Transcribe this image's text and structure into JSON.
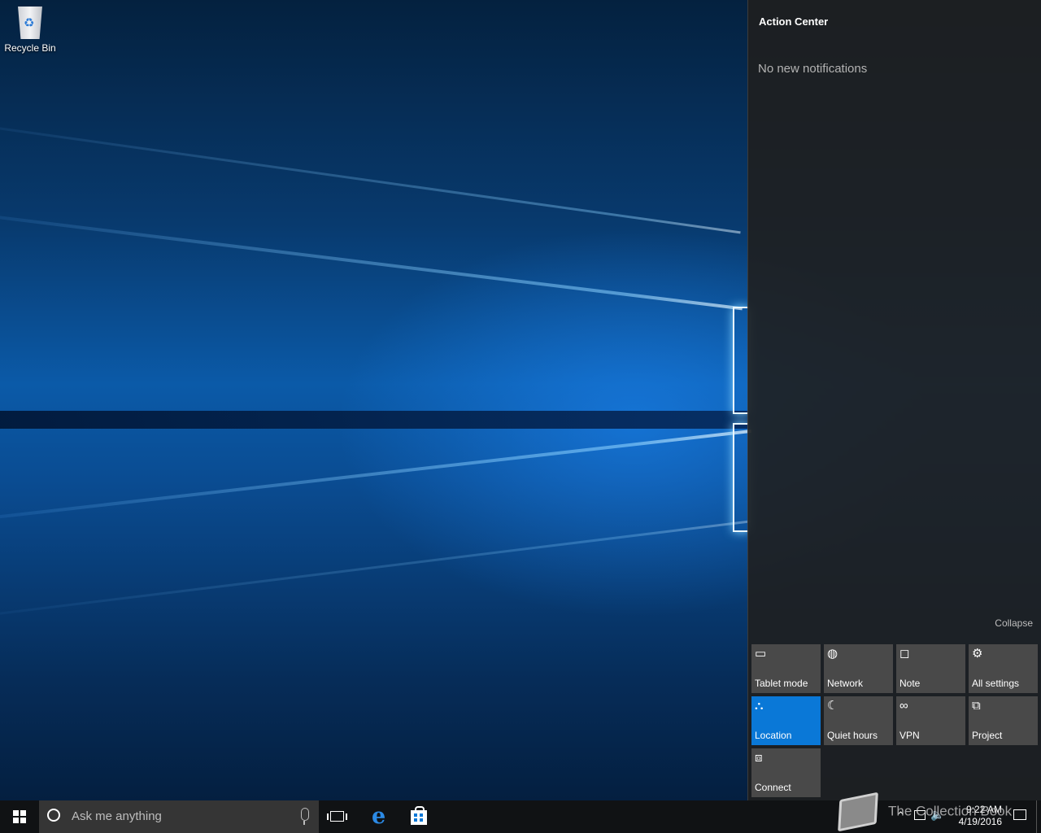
{
  "desktop": {
    "icons": [
      {
        "label": "Recycle Bin",
        "icon": "recycle-bin-icon"
      }
    ]
  },
  "action_center": {
    "title": "Action Center",
    "empty_message": "No new notifications",
    "collapse_label": "Collapse",
    "quick_actions": [
      {
        "label": "Tablet mode",
        "icon": "tablet-mode-icon",
        "active": false
      },
      {
        "label": "Network",
        "icon": "network-globe-icon",
        "active": false
      },
      {
        "label": "Note",
        "icon": "note-icon",
        "active": false
      },
      {
        "label": "All settings",
        "icon": "gear-icon",
        "active": false
      },
      {
        "label": "Location",
        "icon": "location-icon",
        "active": true
      },
      {
        "label": "Quiet hours",
        "icon": "moon-icon",
        "active": false
      },
      {
        "label": "VPN",
        "icon": "vpn-icon",
        "active": false
      },
      {
        "label": "Project",
        "icon": "project-icon",
        "active": false
      },
      {
        "label": "Connect",
        "icon": "connect-icon",
        "active": false
      }
    ]
  },
  "taskbar": {
    "search_placeholder": "Ask me anything",
    "pinned": [
      {
        "icon": "task-view-icon"
      },
      {
        "icon": "edge-icon"
      },
      {
        "icon": "store-icon"
      }
    ],
    "clock": {
      "time": "9:22 AM",
      "date": "4/19/2016"
    }
  },
  "watermark": {
    "text": "The Collection Book"
  },
  "colors": {
    "accent": "#0a78d7",
    "tile": "#494949",
    "panel": "#1f1f1f",
    "taskbar": "#101214"
  }
}
